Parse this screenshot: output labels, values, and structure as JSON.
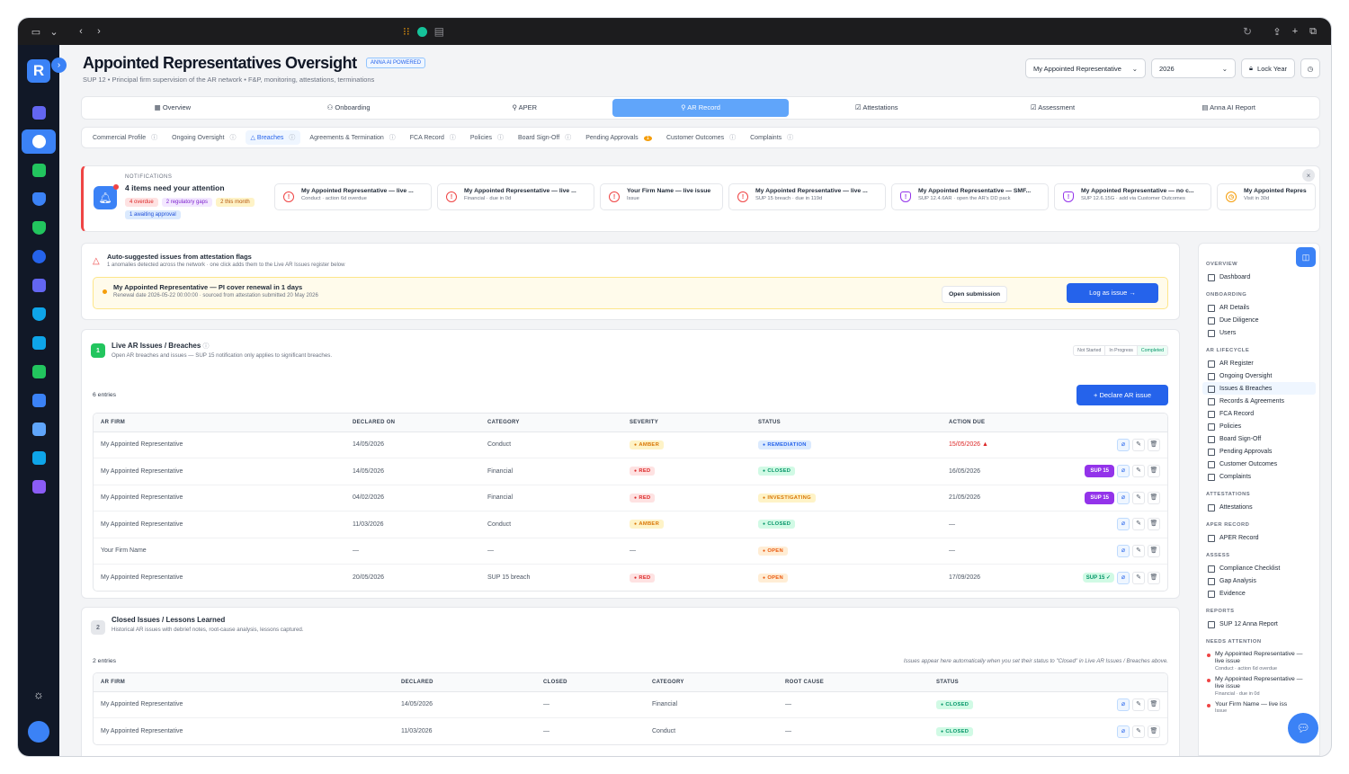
{
  "browser": {
    "url": ""
  },
  "header": {
    "title": "Appointed Representatives Oversight",
    "ai_badge": "ANNA AI POWERED",
    "subtitle": "SUP 12 • Principal firm supervision of the AR network • F&P, monitoring, attestations, terminations",
    "ar_select": "My Appointed Representative",
    "year_select": "2026",
    "lock_label": "Lock Year"
  },
  "main_tabs": [
    {
      "label": "Overview"
    },
    {
      "label": "Onboarding"
    },
    {
      "label": "APER"
    },
    {
      "label": "AR Record"
    },
    {
      "label": "Attestations"
    },
    {
      "label": "Assessment"
    },
    {
      "label": "Anna AI Report"
    }
  ],
  "sub_tabs": [
    {
      "label": "Commercial Profile"
    },
    {
      "label": "Ongoing Oversight"
    },
    {
      "label": "Breaches"
    },
    {
      "label": "Agreements & Termination"
    },
    {
      "label": "FCA Record"
    },
    {
      "label": "Policies"
    },
    {
      "label": "Board Sign-Off"
    },
    {
      "label": "Pending Approvals",
      "badge": "1"
    },
    {
      "label": "Customer Outcomes"
    },
    {
      "label": "Complaints"
    }
  ],
  "notifications": {
    "label": "NOTIFICATIONS",
    "count_text": "4 items need your attention",
    "pills": [
      "4 overdue",
      "2 regulatory gaps",
      "2 this month",
      "1 awaiting approval"
    ],
    "cards": [
      {
        "title": "My Appointed Representative — live ...",
        "sub": "Conduct · action 6d overdue",
        "kind": "alert"
      },
      {
        "title": "My Appointed Representative — live ...",
        "sub": "Financial · due in 0d",
        "kind": "alert"
      },
      {
        "title": "Your Firm Name — live issue",
        "sub": "Issue",
        "kind": "alert"
      },
      {
        "title": "My Appointed Representative — live ...",
        "sub": "SUP 15 breach · due in 119d",
        "kind": "alert"
      },
      {
        "title": "My Appointed Representative — SMF...",
        "sub": "SUP 12.4.6AR · open the AR's DD pack",
        "kind": "shield"
      },
      {
        "title": "My Appointed Representative — no c...",
        "sub": "SUP 12.6.15G · add via Customer Outcomes",
        "kind": "shield"
      },
      {
        "title": "My Appointed Repres",
        "sub": "Visit in 30d",
        "kind": "clock"
      }
    ]
  },
  "suggestions": {
    "title": "Auto-suggested issues from attestation flags",
    "subtitle": "1 anomalies detected across the network · one click adds them to the Live AR Issues register below",
    "item_title": "My Appointed Representative — PI cover renewal in 1 days",
    "item_sub": "Renewal date 2026-05-22 00:00:00 · sourced from attestation submitted 20 May 2026",
    "open_btn": "Open submission",
    "log_btn": "Log as issue →"
  },
  "live": {
    "num": "1",
    "title": "Live AR Issues / Breaches",
    "subtitle": "Open AR breaches and issues — SUP 15 notification only applies to significant breaches.",
    "progress": [
      "Not Started",
      "In Progress",
      "Completed"
    ],
    "count": "6 entries",
    "declare_btn": "+ Declare AR issue",
    "headers": [
      "AR FIRM",
      "DECLARED ON",
      "CATEGORY",
      "SEVERITY",
      "STATUS",
      "ACTION DUE"
    ],
    "rows": [
      {
        "firm": "My Appointed Representative",
        "declared": "14/05/2026",
        "category": "Conduct",
        "severity": "AMBER",
        "status": "REMEDIATION",
        "due": "15/05/2026",
        "sup": ""
      },
      {
        "firm": "My Appointed Representative",
        "declared": "14/05/2026",
        "category": "Financial",
        "severity": "RED",
        "status": "CLOSED",
        "due": "16/05/2026",
        "sup": "SUP 15"
      },
      {
        "firm": "My Appointed Representative",
        "declared": "04/02/2026",
        "category": "Financial",
        "severity": "RED",
        "status": "INVESTIGATING",
        "due": "21/05/2026",
        "sup": "SUP 15"
      },
      {
        "firm": "My Appointed Representative",
        "declared": "11/03/2026",
        "category": "Conduct",
        "severity": "AMBER",
        "status": "CLOSED",
        "due": "—",
        "sup": ""
      },
      {
        "firm": "Your Firm Name",
        "declared": "—",
        "category": "—",
        "severity": "—",
        "status": "OPEN",
        "due": "—",
        "sup": ""
      },
      {
        "firm": "My Appointed Representative",
        "declared": "20/05/2026",
        "category": "SUP 15 breach",
        "severity": "RED",
        "status": "OPEN",
        "due": "17/09/2026",
        "sup": "SUP 15 ✓"
      }
    ]
  },
  "closed": {
    "num": "2",
    "title": "Closed Issues / Lessons Learned",
    "subtitle": "Historical AR issues with debrief notes, root-cause analysis, lessons captured.",
    "count": "2 entries",
    "note": "Issues appear here automatically when you set their status to \"Closed\" in Live AR Issues / Breaches above.",
    "headers": [
      "AR FIRM",
      "DECLARED",
      "CLOSED",
      "CATEGORY",
      "ROOT CAUSE",
      "STATUS"
    ],
    "rows": [
      {
        "firm": "My Appointed Representative",
        "declared": "14/05/2026",
        "closed": "—",
        "category": "Financial",
        "root": "—",
        "status": "CLOSED"
      },
      {
        "firm": "My Appointed Representative",
        "declared": "11/03/2026",
        "closed": "—",
        "category": "Conduct",
        "root": "—",
        "status": "CLOSED"
      }
    ]
  },
  "right_nav": {
    "groups": [
      {
        "h": "OVERVIEW",
        "items": [
          "Dashboard"
        ]
      },
      {
        "h": "ONBOARDING",
        "items": [
          "AR Details",
          "Due Diligence",
          "Users"
        ]
      },
      {
        "h": "AR LIFECYCLE",
        "items": [
          "AR Register",
          "Ongoing Oversight",
          "Issues & Breaches",
          "Records & Agreements",
          "FCA Record",
          "Policies",
          "Board Sign-Off",
          "Pending Approvals",
          "Customer Outcomes",
          "Complaints"
        ]
      },
      {
        "h": "ATTESTATIONS",
        "items": [
          "Attestations"
        ]
      },
      {
        "h": "APER RECORD",
        "items": [
          "APER Record"
        ]
      },
      {
        "h": "ASSESS",
        "items": [
          "Compliance Checklist",
          "Gap Analysis",
          "Evidence"
        ]
      },
      {
        "h": "REPORTS",
        "items": [
          "SUP 12 Anna Report"
        ]
      }
    ],
    "attention_h": "NEEDS ATTENTION",
    "attention": [
      {
        "t": "My Appointed Representative — live issue",
        "s": "Conduct · action 6d overdue"
      },
      {
        "t": "My Appointed Representative — live issue",
        "s": "Financial · due in 0d"
      },
      {
        "t": "Your Firm Name — live iss",
        "s": "Issue"
      }
    ]
  },
  "colors": {
    "accent": "#3b82f6",
    "danger": "#ef4444",
    "sidebar": "#111827"
  }
}
